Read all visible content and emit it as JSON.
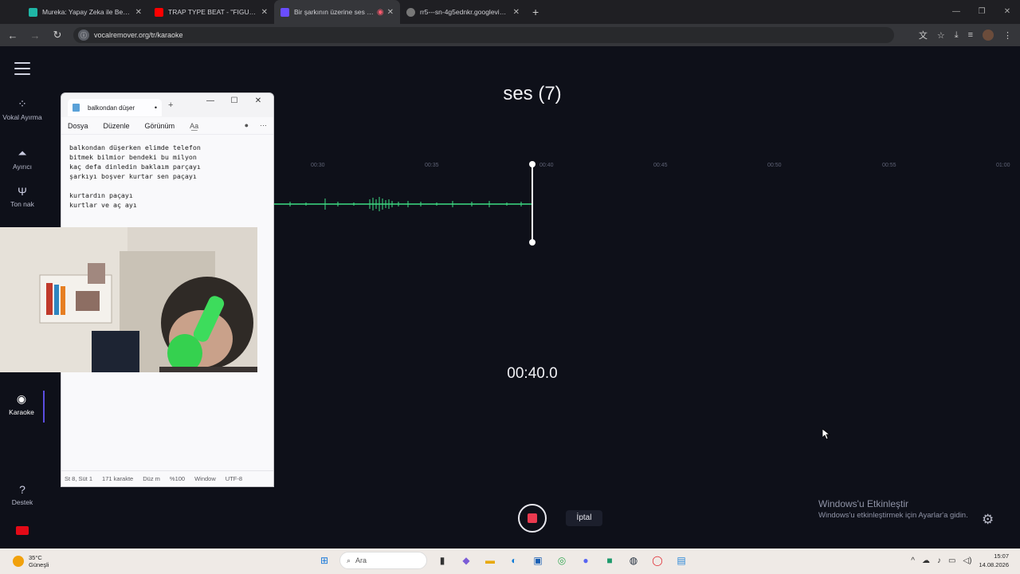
{
  "browser": {
    "tabs": [
      {
        "title": "Mureka: Yapay Zeka ile Benzers",
        "color": "#1fb6a6",
        "active": false
      },
      {
        "title": "TRAP TYPE BEAT - \"FIGURES\" |",
        "color": "#ff0000",
        "active": false
      },
      {
        "title": "Bir şarkının üzerine ses kayd",
        "color": "#6a4dff",
        "active": true
      },
      {
        "title": "rr5---sn-4g5ednkr.googlevideo",
        "color": "#777777",
        "active": false
      }
    ],
    "url": "vocalremover.org/tr/karaoke"
  },
  "sidebar": {
    "items": [
      {
        "label": "Vokal Ayırma",
        "icon": "vocal-split-icon"
      },
      {
        "label": "Ayırıcı",
        "icon": "splitter-icon"
      },
      {
        "label": "Ton nak",
        "icon": "tuning-fork-icon"
      },
      {
        "label": "Karaoke",
        "icon": "karaoke-icon",
        "active": true
      },
      {
        "label": "Destek",
        "icon": "help-icon"
      }
    ]
  },
  "recorder": {
    "title": "ses (7)",
    "timeline_ticks": [
      "00:30",
      "00:35",
      "00:40",
      "00:45",
      "00:50",
      "00:55",
      "01:00"
    ],
    "elapsed": "00:40.0",
    "cancel_label": "İptal",
    "wave_color": "#3ddc84"
  },
  "notepad": {
    "tab_title": "balkondan düşer",
    "menu": [
      "Dosya",
      "Düzenle",
      "Görünüm"
    ],
    "text": "balkondan düşerken elimde telefon\nbitmek bilmior bendeki bu milyon\nkaç defa dinledin baklaım parçayı\nşarkıyı boşver kurtar sen paçayı\n\nkurtardın paçayı\nkurtlar ve aç ayı",
    "status": [
      "St 8, Süt 1",
      "171 karakte",
      "Düz m",
      "%100",
      "Window",
      "UTF-8"
    ]
  },
  "activation": {
    "title": "Windows'u Etkinleştir",
    "subtitle": "Windows'u etkinleştirmek için Ayarlar'a gidin."
  },
  "taskbar": {
    "temperature": "35°C",
    "weather": "Güneşli",
    "search_placeholder": "Ara",
    "time": "15:07",
    "date": "14.08.2026"
  }
}
